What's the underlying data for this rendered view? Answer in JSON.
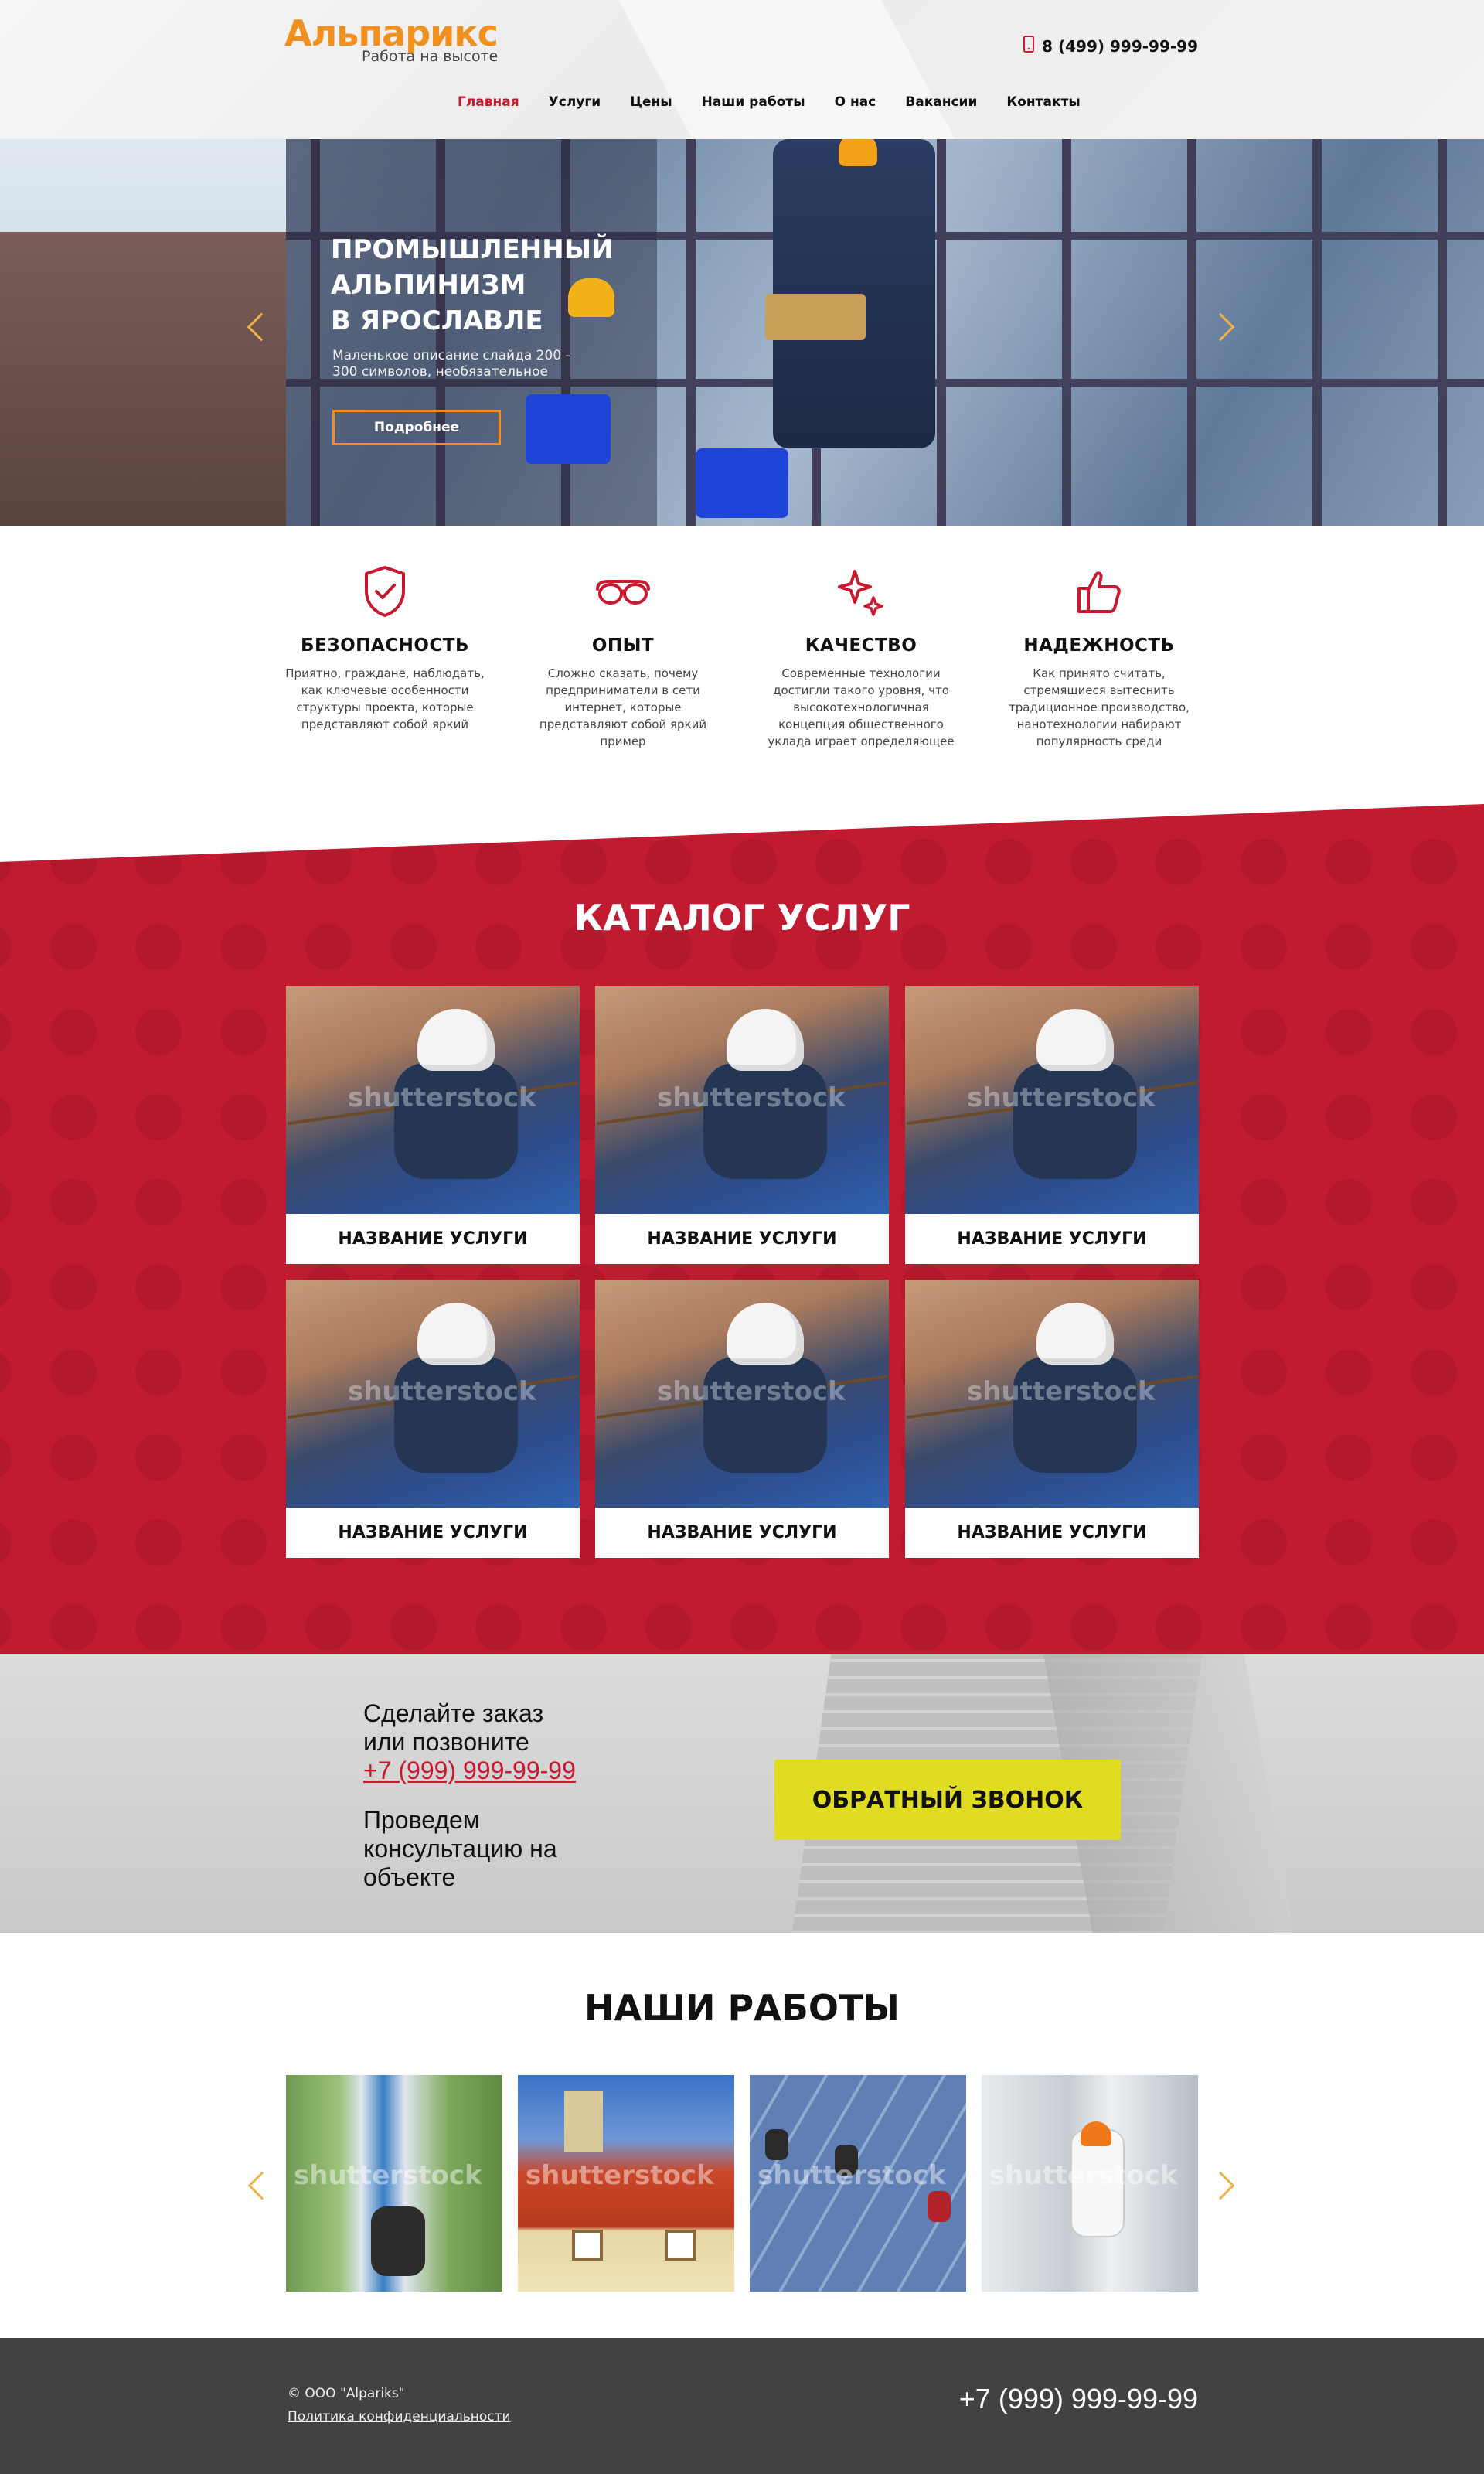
{
  "header": {
    "logo_name": "Альпарикс",
    "logo_tagline": "Работа на высоте",
    "phone": "8 (499) 999-99-99",
    "nav": [
      {
        "label": "Главная",
        "active": true
      },
      {
        "label": "Услуги",
        "active": false
      },
      {
        "label": "Цены",
        "active": false
      },
      {
        "label": "Наши работы",
        "active": false
      },
      {
        "label": "О нас",
        "active": false
      },
      {
        "label": "Вакансии",
        "active": false
      },
      {
        "label": "Контакты",
        "active": false
      }
    ]
  },
  "hero": {
    "title_line1": "ПРОМЫШЛЕННЫЙ",
    "title_line2": "АЛЬПИНИЗМ",
    "title_line3": "В ЯРОСЛАВЛЕ",
    "description": "Маленькое описание слайда 200 - 300 символов, необязательное",
    "button": "Подробнее"
  },
  "features": [
    {
      "icon": "shield-check-icon",
      "title": "БЕЗОПАСНОСТЬ",
      "text": "Приятно, граждане, наблюдать, как ключевые особенности структуры проекта, которые представляют собой яркий"
    },
    {
      "icon": "glasses-icon",
      "title": "ОПЫТ",
      "text": "Сложно сказать, почему предприниматели в сети интернет, которые представляют собой яркий пример"
    },
    {
      "icon": "sparkle-icon",
      "title": "КАЧЕСТВО",
      "text": "Современные технологии достигли такого уровня, что высокотехнологичная концепция общественного уклада играет определяющее"
    },
    {
      "icon": "thumbs-up-icon",
      "title": "НАДЕЖНОСТЬ",
      "text": "Как принято считать, стремящиеся вытеснить традиционное производство, нанотехнологии набирают популярность среди"
    }
  ],
  "catalog": {
    "title": "КАТАЛОГ УСЛУГ",
    "watermark": "shutterstock",
    "items": [
      {
        "label": "НАЗВАНИЕ УСЛУГИ"
      },
      {
        "label": "НАЗВАНИЕ УСЛУГИ"
      },
      {
        "label": "НАЗВАНИЕ УСЛУГИ"
      },
      {
        "label": "НАЗВАНИЕ УСЛУГИ"
      },
      {
        "label": "НАЗВАНИЕ УСЛУГИ"
      },
      {
        "label": "НАЗВАНИЕ УСЛУГИ"
      }
    ]
  },
  "callback": {
    "line1": "Сделайте заказ",
    "line2": "или позвоните",
    "phone": "+7 (999) 999-99-99",
    "line3": "Проведем",
    "line4": "консультацию на",
    "line5": "объекте",
    "button": "ОБРАТНЫЙ ЗВОНОК"
  },
  "works": {
    "title": "НАШИ РАБОТЫ",
    "watermark": "shutterstock"
  },
  "footer": {
    "copyright": "© ООО \"Alpariks\"",
    "policy": "Политика конфиденциальности",
    "phone": "+7 (999) 999-99-99"
  },
  "colors": {
    "accent_red": "#c11b31",
    "accent_orange": "#f0901e",
    "callback_yellow": "#e0dc21",
    "footer_bg": "#424242"
  }
}
